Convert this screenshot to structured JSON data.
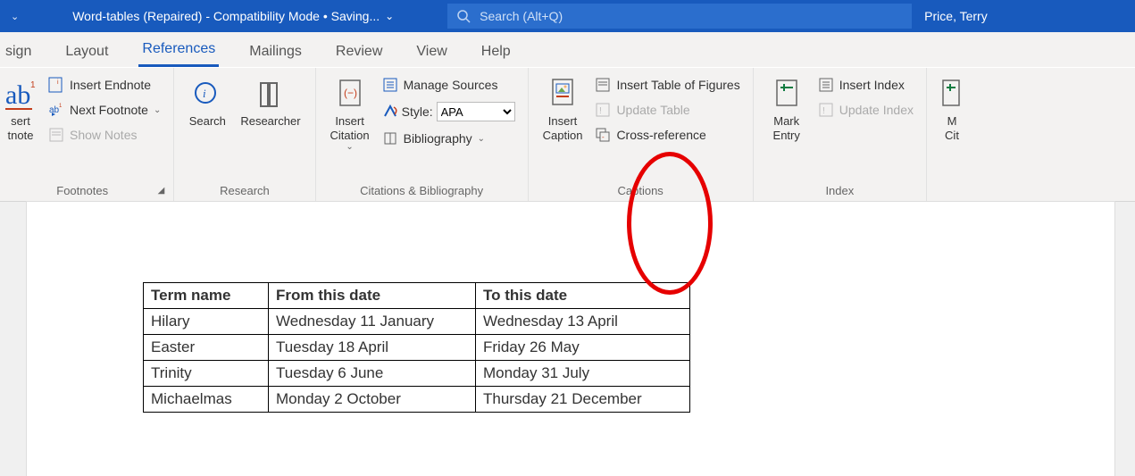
{
  "titlebar": {
    "doc_title": "Word-tables (Repaired)  -  Compatibility Mode • Saving...",
    "chevron": "⌄",
    "user": "Price, Terry"
  },
  "search": {
    "placeholder": "Search (Alt+Q)"
  },
  "tabs": {
    "design": "sign",
    "layout": "Layout",
    "references": "References",
    "mailings": "Mailings",
    "review": "Review",
    "view": "View",
    "help": "Help"
  },
  "ribbon": {
    "footnotes": {
      "bigbtn_line1": "sert",
      "bigbtn_line2": "tnote",
      "insert_endnote": "Insert Endnote",
      "next_footnote": "Next Footnote",
      "show_notes": "Show Notes",
      "group": "Footnotes"
    },
    "research": {
      "search": "Search",
      "researcher": "Researcher",
      "group": "Research"
    },
    "citations": {
      "insert_citation": "Insert\nCitation",
      "manage_sources": "Manage Sources",
      "style_label": "Style:",
      "style_value": "APA",
      "bibliography": "Bibliography",
      "group": "Citations & Bibliography"
    },
    "captions": {
      "insert_caption": "Insert\nCaption",
      "insert_tof": "Insert Table of Figures",
      "update_table": "Update Table",
      "cross_ref": "Cross-reference",
      "group": "Captions"
    },
    "index": {
      "mark_entry": "Mark\nEntry",
      "insert_index": "Insert Index",
      "update_index": "Update Index",
      "group": "Index"
    },
    "toa": {
      "btn": "M\nCit"
    }
  },
  "table": {
    "headers": [
      "Term name",
      "From this date",
      "To this date"
    ],
    "rows": [
      [
        "Hilary",
        "Wednesday 11 January",
        "Wednesday 13 April"
      ],
      [
        "Easter",
        "Tuesday 18 April",
        "Friday 26 May"
      ],
      [
        "Trinity",
        "Tuesday 6 June",
        "Monday 31 July"
      ],
      [
        "Michaelmas",
        "Monday 2 October",
        "Thursday 21 December"
      ]
    ]
  }
}
